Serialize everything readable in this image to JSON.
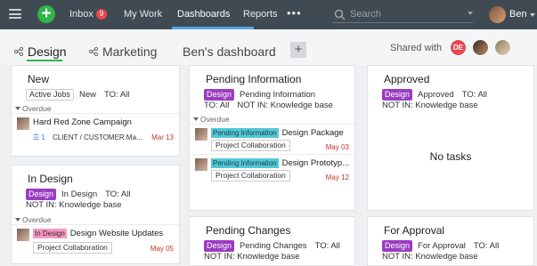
{
  "topbar": {
    "inbox_label": "Inbox",
    "inbox_count": "9",
    "mywork_label": "My Work",
    "dashboards_label": "Dashboards",
    "reports_label": "Reports",
    "more_label": "•••",
    "search_placeholder": "Search",
    "user_name": "Ben",
    "accent_color": "#2fb549"
  },
  "tabs": {
    "design": "Design",
    "marketing": "Marketing",
    "bens": "Ben's dashboard",
    "add": "+",
    "shared_label": "Shared with",
    "shared_initials": "DE"
  },
  "panels": {
    "new": {
      "title": "New",
      "filter_pill": "Active Jobs",
      "filter_status": "New",
      "filter_to": "TO: All",
      "overdue_label": "Overdue",
      "task": {
        "title": "Hard Red Zone Campaign",
        "sub_count": "1",
        "client": "CLIENT / CUSTOMER:Ma...",
        "date": "Mar 13"
      }
    },
    "in_design": {
      "title": "In Design",
      "tag": "Design",
      "filter_status": "In Design",
      "filter_to": "TO: All",
      "filter_not": "NOT IN: Knowledge base",
      "overdue_label": "Overdue",
      "task": {
        "status": "In Design",
        "title": "Design Website Updates",
        "project": "Project Collaboration",
        "date": "May 05"
      }
    },
    "pending_info": {
      "title": "Pending Information",
      "tag": "Design",
      "filter_status": "Pending Information",
      "filter_to": "TO: All",
      "filter_not": "NOT IN: Knowledge base",
      "overdue_label": "Overdue",
      "tasks": [
        {
          "status": "Pending Information",
          "title": "Design Package",
          "project": "Project Collaboration",
          "date": "May 03"
        },
        {
          "status": "Pending Information",
          "title": "Design Prototyp...",
          "project": "Project Collaboration",
          "date": "May 12"
        }
      ]
    },
    "approved": {
      "title": "Approved",
      "tag": "Design",
      "filter_status": "Approved",
      "filter_to": "TO: All",
      "filter_not": "NOT IN: Knowledge base",
      "empty": "No tasks"
    },
    "pending_changes": {
      "title": "Pending Changes",
      "tag": "Design",
      "filter_status": "Pending Changes",
      "filter_to": "TO: All",
      "filter_not": "NOT IN: Knowledge base"
    },
    "for_approval": {
      "title": "For Approval",
      "tag": "Design",
      "filter_status": "For Approval",
      "filter_to": "TO: All",
      "filter_not": "NOT IN: Knowledge base"
    }
  }
}
